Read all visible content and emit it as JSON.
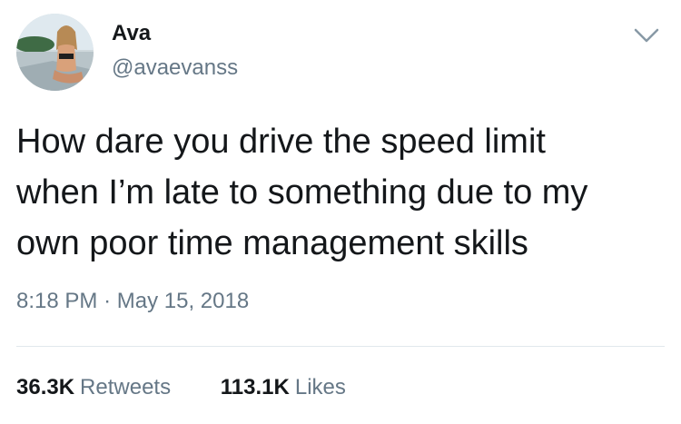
{
  "author": {
    "display_name": "Ava",
    "handle": "@avaevanss"
  },
  "icons": {
    "avatar": "profile-photo",
    "menu": "chevron-down-icon"
  },
  "tweet": {
    "lines": [
      "How dare you drive the speed limit",
      "when I’m late to something due to my",
      "own poor time management skills"
    ],
    "time": "8:18 PM",
    "separator": "·",
    "date": "May 15, 2018"
  },
  "stats": {
    "retweets_count": "36.3K",
    "retweets_label": "Retweets",
    "likes_count": "113.1K",
    "likes_label": "Likes"
  },
  "colors": {
    "text": "#14171a",
    "secondary": "#657786",
    "divider": "#e1e8ed"
  }
}
